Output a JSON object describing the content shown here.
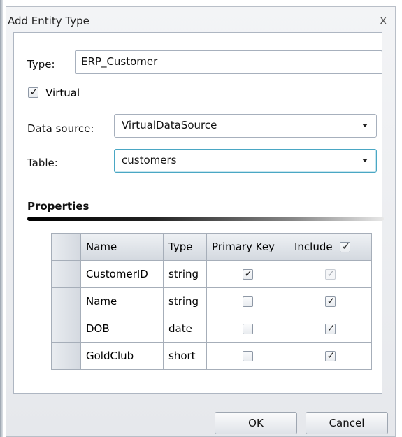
{
  "window": {
    "title": "Add Entity Type",
    "close_label": "x"
  },
  "form": {
    "type_label": "Type:",
    "type_value": "ERP_Customer",
    "virtual_label": "Virtual",
    "virtual_checked": true,
    "datasource_label": "Data source:",
    "datasource_value": "VirtualDataSource",
    "table_label": "Table:",
    "table_value": "customers"
  },
  "properties": {
    "title": "Properties",
    "columns": [
      "Name",
      "Type",
      "Primary Key",
      "Include"
    ],
    "include_all_checked": true,
    "rows": [
      {
        "name": "CustomerID",
        "type": "string",
        "primary_key": true,
        "include": true,
        "include_disabled": true
      },
      {
        "name": "Name",
        "type": "string",
        "primary_key": false,
        "include": true,
        "include_disabled": false
      },
      {
        "name": "DOB",
        "type": "date",
        "primary_key": false,
        "include": true,
        "include_disabled": false
      },
      {
        "name": "GoldClub",
        "type": "short",
        "primary_key": false,
        "include": true,
        "include_disabled": false
      }
    ]
  },
  "buttons": {
    "ok": "OK",
    "cancel": "Cancel"
  },
  "check_glyph": "✓"
}
